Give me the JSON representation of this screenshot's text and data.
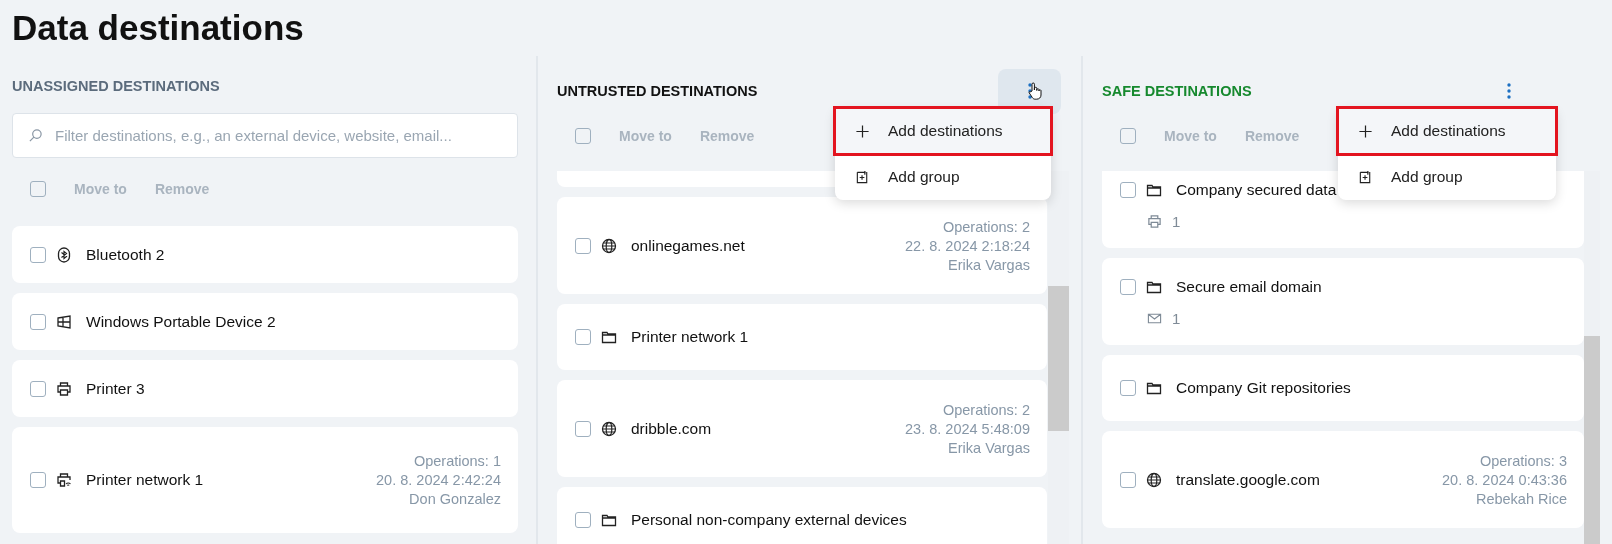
{
  "page": {
    "title": "Data destinations"
  },
  "columns": [
    {
      "title": "UNASSIGNED DESTINATIONS",
      "color": "#5b6b7c",
      "search": {
        "placeholder": "Filter destinations, e.g., an external device, website, email..."
      },
      "toolbar": {
        "select_all": false,
        "actions": [
          {
            "label": "Move to",
            "disabled": true
          },
          {
            "label": "Remove",
            "disabled": true
          }
        ]
      },
      "items": [
        {
          "kind": "bluetooth",
          "name": "Bluetooth 2",
          "checked": false
        },
        {
          "kind": "windows",
          "name": "Windows Portable Device 2",
          "checked": false
        },
        {
          "kind": "printer",
          "name": "Printer 3",
          "checked": false
        },
        {
          "kind": "network-printer",
          "name": "Printer network 1",
          "checked": false,
          "meta": [
            "Operations: 1",
            "20. 8. 2024 2:42:24",
            "Don Gonzalez"
          ]
        }
      ]
    },
    {
      "title": "UNTRUSTED DESTINATIONS",
      "color": "#111111",
      "menu": {
        "hovered": true,
        "open": true,
        "items": [
          {
            "kind": "plus",
            "label": "Add destinations",
            "highlighted": true
          },
          {
            "kind": "group",
            "label": "Add group",
            "highlighted": false
          }
        ]
      },
      "toolbar": {
        "select_all": false,
        "actions": [
          {
            "label": "Move to",
            "disabled": true
          },
          {
            "label": "Remove",
            "disabled": true
          }
        ]
      },
      "items": [
        {
          "kind": "globe",
          "name": "onlinegames.net",
          "checked": false,
          "meta": [
            "Operations: 2",
            "22. 8. 2024 2:18:24",
            "Erika Vargas"
          ]
        },
        {
          "kind": "folder",
          "name": "Printer network 1",
          "checked": false
        },
        {
          "kind": "globe",
          "name": "dribble.com",
          "checked": false,
          "meta": [
            "Operations: 2",
            "23. 8. 2024 5:48:09",
            "Erika Vargas"
          ]
        },
        {
          "kind": "folder",
          "name": "Personal non-company external devices",
          "checked": false
        }
      ]
    },
    {
      "title": "SAFE DESTINATIONS",
      "color": "#16892e",
      "menu": {
        "hovered": false,
        "open": true,
        "items": [
          {
            "kind": "plus",
            "label": "Add destinations",
            "highlighted": true
          },
          {
            "kind": "group",
            "label": "Add group",
            "highlighted": false
          }
        ]
      },
      "toolbar": {
        "select_all": false,
        "actions": [
          {
            "label": "Move to",
            "disabled": true
          },
          {
            "label": "Remove",
            "disabled": true
          }
        ]
      },
      "items": [
        {
          "kind": "folder",
          "name": "Company secured data",
          "checked": false,
          "sub": {
            "kind": "printer",
            "count": "1"
          }
        },
        {
          "kind": "folder",
          "name": "Secure email domain",
          "checked": false,
          "sub": {
            "kind": "mail",
            "count": "1"
          }
        },
        {
          "kind": "folder",
          "name": "Company Git repositories",
          "checked": false
        },
        {
          "kind": "globe",
          "name": "translate.google.com",
          "checked": false,
          "meta": [
            "Operations: 3",
            "20. 8. 2024 0:43:36",
            "Rebekah Rice"
          ]
        }
      ]
    }
  ]
}
